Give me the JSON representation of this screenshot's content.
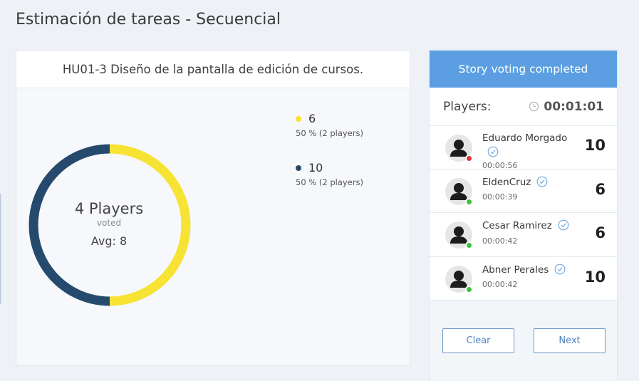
{
  "page": {
    "title": "Estimación de tareas - Secuencial"
  },
  "story": {
    "title": "HU01-3 Diseño de la pantalla de edición de cursos."
  },
  "summary": {
    "players_count": "4 Players",
    "voted_label": "voted",
    "avg_text": "Avg: 8",
    "legend": [
      {
        "value": "6",
        "detail": "50 % (2 players)",
        "color": "#f6e333",
        "fraction": 0.5
      },
      {
        "value": "10",
        "detail": "50 % (2 players)",
        "color": "#254a6e",
        "fraction": 0.5
      }
    ]
  },
  "panel": {
    "banner": "Story voting completed",
    "players_label": "Players:",
    "timer": "00:01:01",
    "players": [
      {
        "name": "Eduardo Morgado",
        "time": "00:00:56",
        "vote": "10",
        "status": "offline",
        "status_color": "#e0343a",
        "check_below": true
      },
      {
        "name": "EldenCruz",
        "time": "00:00:39",
        "vote": "6",
        "status": "online",
        "status_color": "#3cc13b",
        "check_below": false
      },
      {
        "name": "Cesar Ramirez",
        "time": "00:00:42",
        "vote": "6",
        "status": "online",
        "status_color": "#3cc13b",
        "check_below": false
      },
      {
        "name": "Abner Perales",
        "time": "00:00:42",
        "vote": "10",
        "status": "online",
        "status_color": "#3cc13b",
        "check_below": false
      }
    ],
    "buttons": {
      "clear": "Clear",
      "next": "Next"
    }
  },
  "colors": {
    "accent": "#5b9fe2",
    "donut_yellow": "#f6e333",
    "donut_navy": "#254a6e",
    "button_text": "#4b80bd"
  }
}
